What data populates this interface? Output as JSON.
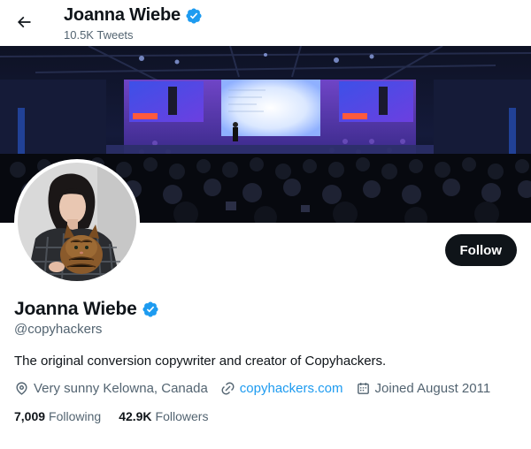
{
  "header": {
    "title": "Joanna Wiebe",
    "tweet_count": "10.5K Tweets"
  },
  "profile": {
    "display_name": "Joanna Wiebe",
    "handle": "@copyhackers",
    "bio": "The original conversion copywriter and creator of Copyhackers.",
    "location": "Very sunny Kelowna, Canada",
    "website": "copyhackers.com",
    "joined": "Joined August 2011",
    "verified": true
  },
  "stats": {
    "following_count": "7,009",
    "following_label": "Following",
    "followers_count": "42.9K",
    "followers_label": "Followers"
  },
  "actions": {
    "follow_label": "Follow"
  },
  "colors": {
    "accent": "#1d9bf0",
    "text_primary": "#0f1419",
    "text_secondary": "#536471",
    "button_bg": "#0f1419"
  },
  "icons": {
    "back": "arrow-left-icon",
    "verified": "verified-badge-icon",
    "location": "location-pin-icon",
    "link": "link-icon",
    "calendar": "calendar-icon"
  }
}
